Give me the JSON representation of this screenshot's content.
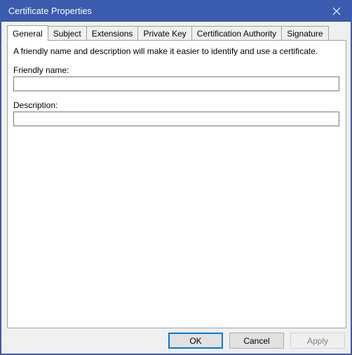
{
  "window": {
    "title": "Certificate Properties",
    "close_icon": "close-icon",
    "accent_color": "#3b5bae",
    "focus_border_color": "#0078d7"
  },
  "tabs": [
    {
      "label": "General",
      "selected": true
    },
    {
      "label": "Subject",
      "selected": false
    },
    {
      "label": "Extensions",
      "selected": false
    },
    {
      "label": "Private Key",
      "selected": false
    },
    {
      "label": "Certification Authority",
      "selected": false
    },
    {
      "label": "Signature",
      "selected": false
    }
  ],
  "general": {
    "intro": "A friendly name and description will make it easier to identify and use a certificate.",
    "friendly_name": {
      "label": "Friendly name:",
      "value": "",
      "placeholder": ""
    },
    "description": {
      "label": "Description:",
      "value": "",
      "placeholder": ""
    }
  },
  "buttons": {
    "ok": "OK",
    "cancel": "Cancel",
    "apply": "Apply"
  }
}
